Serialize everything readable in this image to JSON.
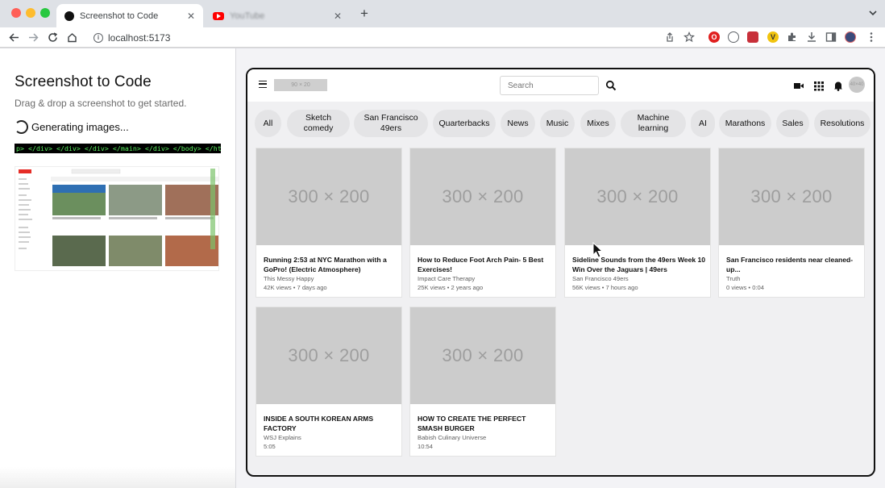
{
  "browser": {
    "tabs": [
      {
        "title": "Screenshot to Code",
        "favicon": "circle-icon",
        "active": true
      },
      {
        "title": "YouTube",
        "favicon": "youtube-icon",
        "active": false
      }
    ],
    "url": "localhost:5173",
    "close_glyph": "✕",
    "new_tab_glyph": "+"
  },
  "left_panel": {
    "title": "Screenshot to Code",
    "subtitle": "Drag & drop a screenshot to get started.",
    "status": "Generating images...",
    "code_snippet": "p> </div> </div> </div> </main> </div> </body> </html>"
  },
  "preview": {
    "logo_placeholder": "90 × 20",
    "search_placeholder": "Search",
    "avatar_placeholder": "40×40",
    "chips": [
      "All",
      "Sketch comedy",
      "San Francisco 49ers",
      "Quarterbacks",
      "News",
      "Music",
      "Mixes",
      "Machine learning",
      "AI",
      "Marathons",
      "Sales",
      "Resolutions"
    ],
    "videos": [
      {
        "thumb": "300 × 200",
        "title": "Running 2:53 at NYC Marathon with a GoPro! (Electric Atmosphere)",
        "channel": "This Messy Happy",
        "meta": "42K views • 7 days ago"
      },
      {
        "thumb": "300 × 200",
        "title": "How to Reduce Foot Arch Pain- 5 Best Exercises!",
        "channel": "Impact Care Therapy",
        "meta": "25K views • 2 years ago"
      },
      {
        "thumb": "300 × 200",
        "title": "Sideline Sounds from the 49ers Week 10 Win Over the Jaguars | 49ers",
        "channel": "San Francisco 49ers",
        "meta": "56K views • 7 hours ago"
      },
      {
        "thumb": "300 × 200",
        "title": "San Francisco residents near cleaned-up...",
        "channel": "Truth",
        "meta": "0 views • 0:04"
      },
      {
        "thumb": "300 × 200",
        "title": "INSIDE A SOUTH KOREAN ARMS FACTORY",
        "channel": "WSJ Explains",
        "meta": "5:05"
      },
      {
        "thumb": "300 × 200",
        "title": "HOW TO CREATE THE PERFECT SMASH BURGER",
        "channel": "Babish Culinary Universe",
        "meta": "10:54"
      }
    ]
  },
  "colors": {
    "chrome_bg": "#dee1e6",
    "code_green": "#5cf262",
    "placeholder_gray": "#cccccc",
    "chip_bg": "#e4e4e6"
  }
}
